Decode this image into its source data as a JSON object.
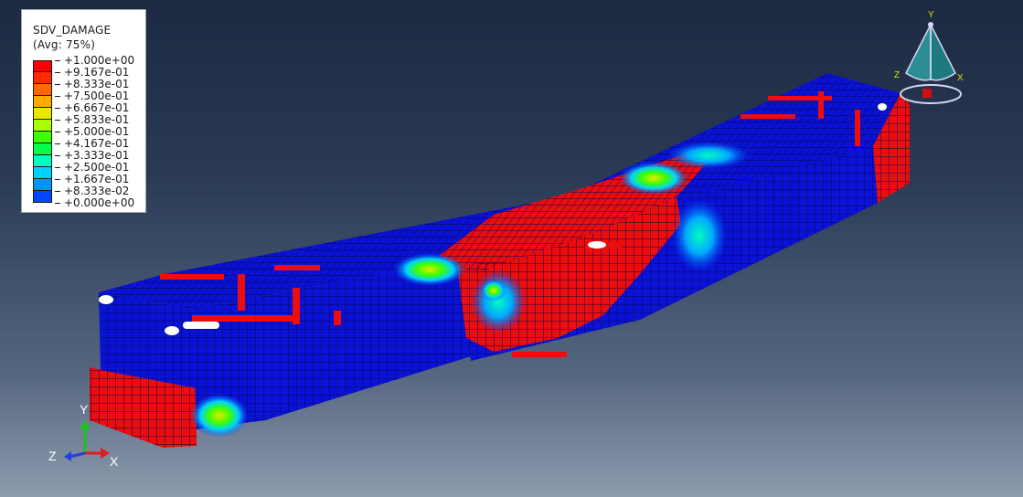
{
  "legend": {
    "variable": "SDV_DAMAGE",
    "avg_label": "(Avg: 75%)",
    "entries": [
      {
        "value": "+1.000e+00",
        "color": "#ff0000"
      },
      {
        "value": "+9.167e-01",
        "color": "#ff2a00"
      },
      {
        "value": "+8.333e-01",
        "color": "#ff6a00"
      },
      {
        "value": "+7.500e-01",
        "color": "#ffaa00"
      },
      {
        "value": "+6.667e-01",
        "color": "#e8e800"
      },
      {
        "value": "+5.833e-01",
        "color": "#a8ff00"
      },
      {
        "value": "+5.000e-01",
        "color": "#3cff00"
      },
      {
        "value": "+4.167e-01",
        "color": "#00ff46"
      },
      {
        "value": "+3.333e-01",
        "color": "#00ffbe"
      },
      {
        "value": "+2.500e-01",
        "color": "#00d2ff"
      },
      {
        "value": "+1.667e-01",
        "color": "#0094ff"
      },
      {
        "value": "+8.333e-02",
        "color": "#0048ff"
      },
      {
        "value": "+0.000e+00",
        "color": "#0000e6"
      }
    ]
  },
  "triad": {
    "x": "X",
    "y": "Y",
    "z": "Z"
  },
  "view_cube": {
    "x": "X",
    "y": "Y",
    "z": "Z"
  },
  "colors": {
    "mesh_blue": "#0a12d8",
    "mesh_red": "#ee0d0d",
    "grid_line": "#06084a"
  }
}
